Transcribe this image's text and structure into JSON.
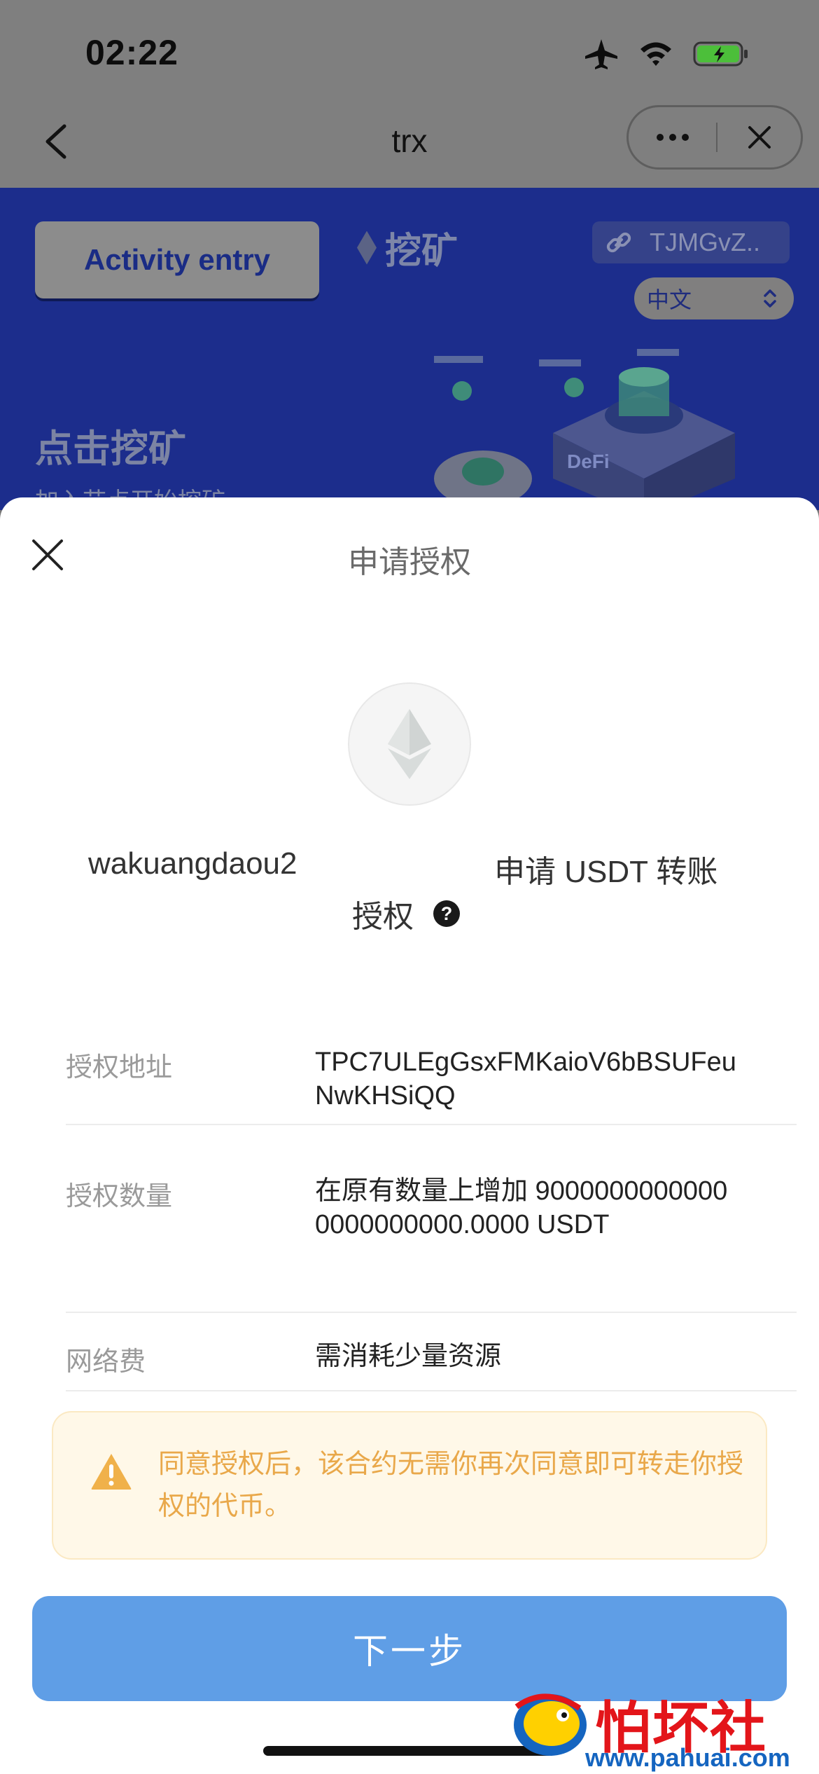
{
  "status_bar": {
    "time": "02:22"
  },
  "nav": {
    "title": "trx"
  },
  "banner": {
    "activity_button": "Activity entry",
    "mining_label": "挖矿",
    "address_chip": "TJMGvZ..",
    "language": "中文",
    "headline": "点击挖矿",
    "subline": "加入节点开始挖矿",
    "illustration_label": "DeFi"
  },
  "modal": {
    "title": "申请授权",
    "app_name": "wakuangdaou2",
    "request_text": "申请 USDT 转账",
    "request_tail": "授权",
    "help_symbol": "?",
    "rows": [
      {
        "label": "授权地址",
        "value": "TPC7ULEgGsxFMKaioV6bBSUFeuNwKHSiQQ"
      },
      {
        "label": "授权数量",
        "value": "在原有数量上增加 90000000000000000000000.0000 USDT"
      },
      {
        "label": "网络费",
        "value": "需消耗少量资源"
      }
    ],
    "warning": "同意授权后，该合约无需你再次同意即可转走你授权的代币。",
    "next_button": "下一步"
  },
  "watermark": {
    "text": "怕坏社区",
    "url": "www.pahuai.com"
  },
  "colors": {
    "banner_bg": "#1c2d8c",
    "primary_button": "#5f9ee6",
    "warning_bg": "#fff8e8",
    "warning_text": "#e9a84a"
  }
}
